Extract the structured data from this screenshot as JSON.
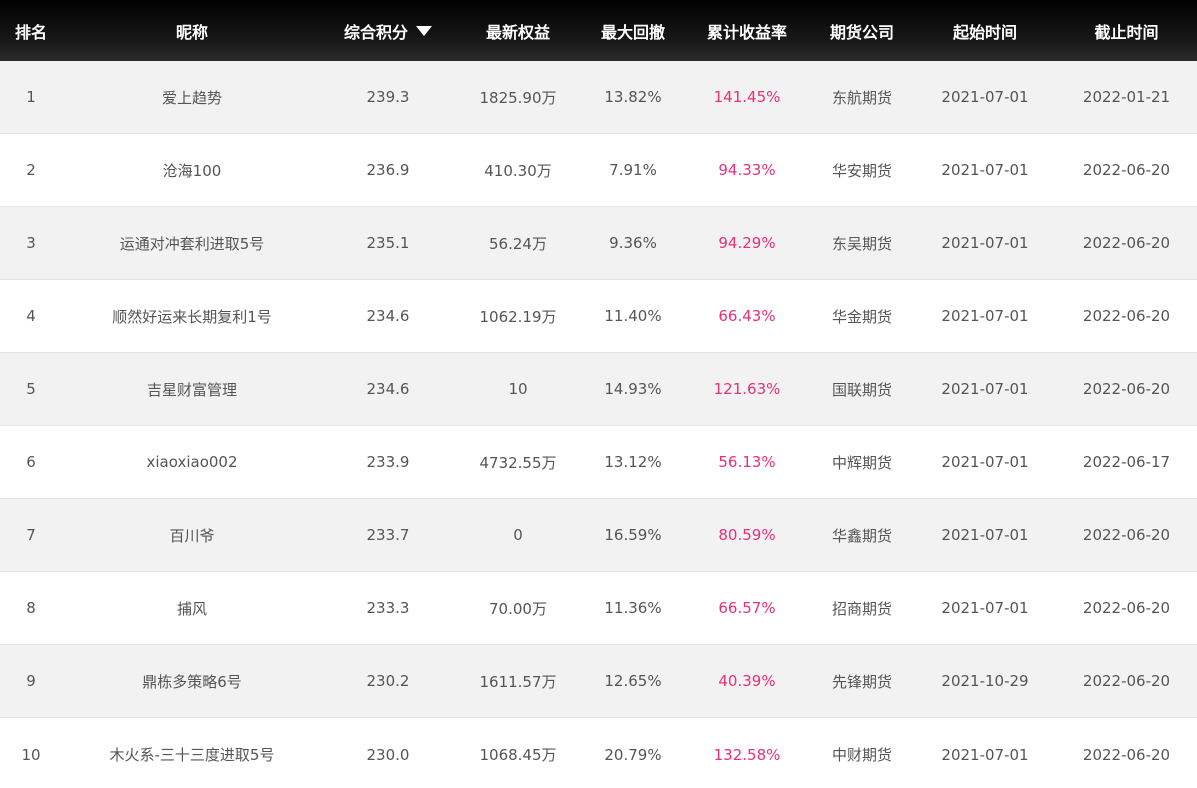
{
  "table": {
    "columns": {
      "rank": "排名",
      "name": "昵称",
      "score": "综合积分",
      "equity": "最新权益",
      "drawdown": "最大回撤",
      "return": "累计收益率",
      "company": "期货公司",
      "start": "起始时间",
      "end": "截止时间"
    },
    "sort_icon": "triangle-down-icon",
    "accent_color": "#e8307a",
    "rows": [
      {
        "rank": "1",
        "name": "爱上趋势",
        "score": "239.3",
        "equity": "1825.90万",
        "drawdown": "13.82%",
        "return": "141.45%",
        "company": "东航期货",
        "start": "2021-07-01",
        "end": "2022-01-21"
      },
      {
        "rank": "2",
        "name": "沧海100",
        "score": "236.9",
        "equity": "410.30万",
        "drawdown": "7.91%",
        "return": "94.33%",
        "company": "华安期货",
        "start": "2021-07-01",
        "end": "2022-06-20"
      },
      {
        "rank": "3",
        "name": "运通对冲套利进取5号",
        "score": "235.1",
        "equity": "56.24万",
        "drawdown": "9.36%",
        "return": "94.29%",
        "company": "东吴期货",
        "start": "2021-07-01",
        "end": "2022-06-20"
      },
      {
        "rank": "4",
        "name": "顺然好运来长期复利1号",
        "score": "234.6",
        "equity": "1062.19万",
        "drawdown": "11.40%",
        "return": "66.43%",
        "company": "华金期货",
        "start": "2021-07-01",
        "end": "2022-06-20"
      },
      {
        "rank": "5",
        "name": "吉星财富管理",
        "score": "234.6",
        "equity": "10",
        "drawdown": "14.93%",
        "return": "121.63%",
        "company": "国联期货",
        "start": "2021-07-01",
        "end": "2022-06-20"
      },
      {
        "rank": "6",
        "name": "xiaoxiao002",
        "score": "233.9",
        "equity": "4732.55万",
        "drawdown": "13.12%",
        "return": "56.13%",
        "company": "中辉期货",
        "start": "2021-07-01",
        "end": "2022-06-17"
      },
      {
        "rank": "7",
        "name": "百川爷",
        "score": "233.7",
        "equity": "0",
        "drawdown": "16.59%",
        "return": "80.59%",
        "company": "华鑫期货",
        "start": "2021-07-01",
        "end": "2022-06-20"
      },
      {
        "rank": "8",
        "name": "捕风",
        "score": "233.3",
        "equity": "70.00万",
        "drawdown": "11.36%",
        "return": "66.57%",
        "company": "招商期货",
        "start": "2021-07-01",
        "end": "2022-06-20"
      },
      {
        "rank": "9",
        "name": "鼎栋多策略6号",
        "score": "230.2",
        "equity": "1611.57万",
        "drawdown": "12.65%",
        "return": "40.39%",
        "company": "先锋期货",
        "start": "2021-10-29",
        "end": "2022-06-20"
      },
      {
        "rank": "10",
        "name": "木火系-三十三度进取5号",
        "score": "230.0",
        "equity": "1068.45万",
        "drawdown": "20.79%",
        "return": "132.58%",
        "company": "中财期货",
        "start": "2021-07-01",
        "end": "2022-06-20"
      }
    ]
  }
}
